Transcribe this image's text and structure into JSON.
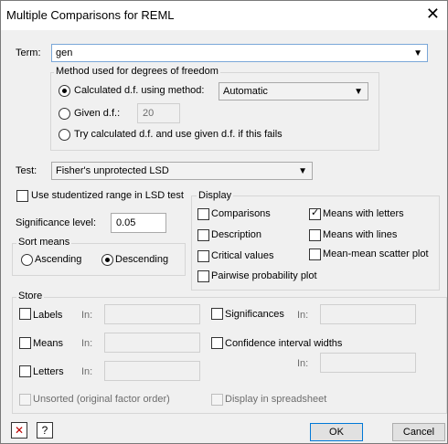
{
  "window": {
    "title": "Multiple Comparisons for REML",
    "close_icon": "close-icon"
  },
  "term": {
    "label": "Term:",
    "value": "gen"
  },
  "df": {
    "group_label": "Method used for degrees of freedom",
    "calc_label": "Calculated d.f. using method:",
    "method_value": "Automatic",
    "given_label": "Given d.f.:",
    "given_value": "20",
    "try_label": "Try calculated d.f. and use given d.f. if this fails"
  },
  "test": {
    "label": "Test:",
    "value": "Fisher's unprotected LSD"
  },
  "studentized": {
    "label": "Use studentized range in LSD test",
    "checked": false
  },
  "significance": {
    "label": "Significance level:",
    "value": "0.05"
  },
  "sort": {
    "group_label": "Sort means",
    "ascending": "Ascending",
    "descending": "Descending",
    "selected": "Descending"
  },
  "display": {
    "group_label": "Display",
    "comparisons": "Comparisons",
    "description": "Description",
    "critical_values": "Critical values",
    "pairwise": "Pairwise probability plot",
    "means_letters": "Means with letters",
    "means_lines": "Means with lines",
    "mean_scatter": "Mean-mean scatter plot",
    "means_letters_checked": true
  },
  "store": {
    "group_label": "Store",
    "labels": "Labels",
    "means": "Means",
    "letters": "Letters",
    "in_label": "In:",
    "significances": "Significances",
    "ci_widths": "Confidence interval widths",
    "unsorted": "Unsorted (original factor order)",
    "spreadsheet": "Display in spreadsheet"
  },
  "buttons": {
    "ok": "OK",
    "cancel": "Cancel",
    "clear_icon": "clear-icon",
    "help_icon": "help-icon"
  }
}
